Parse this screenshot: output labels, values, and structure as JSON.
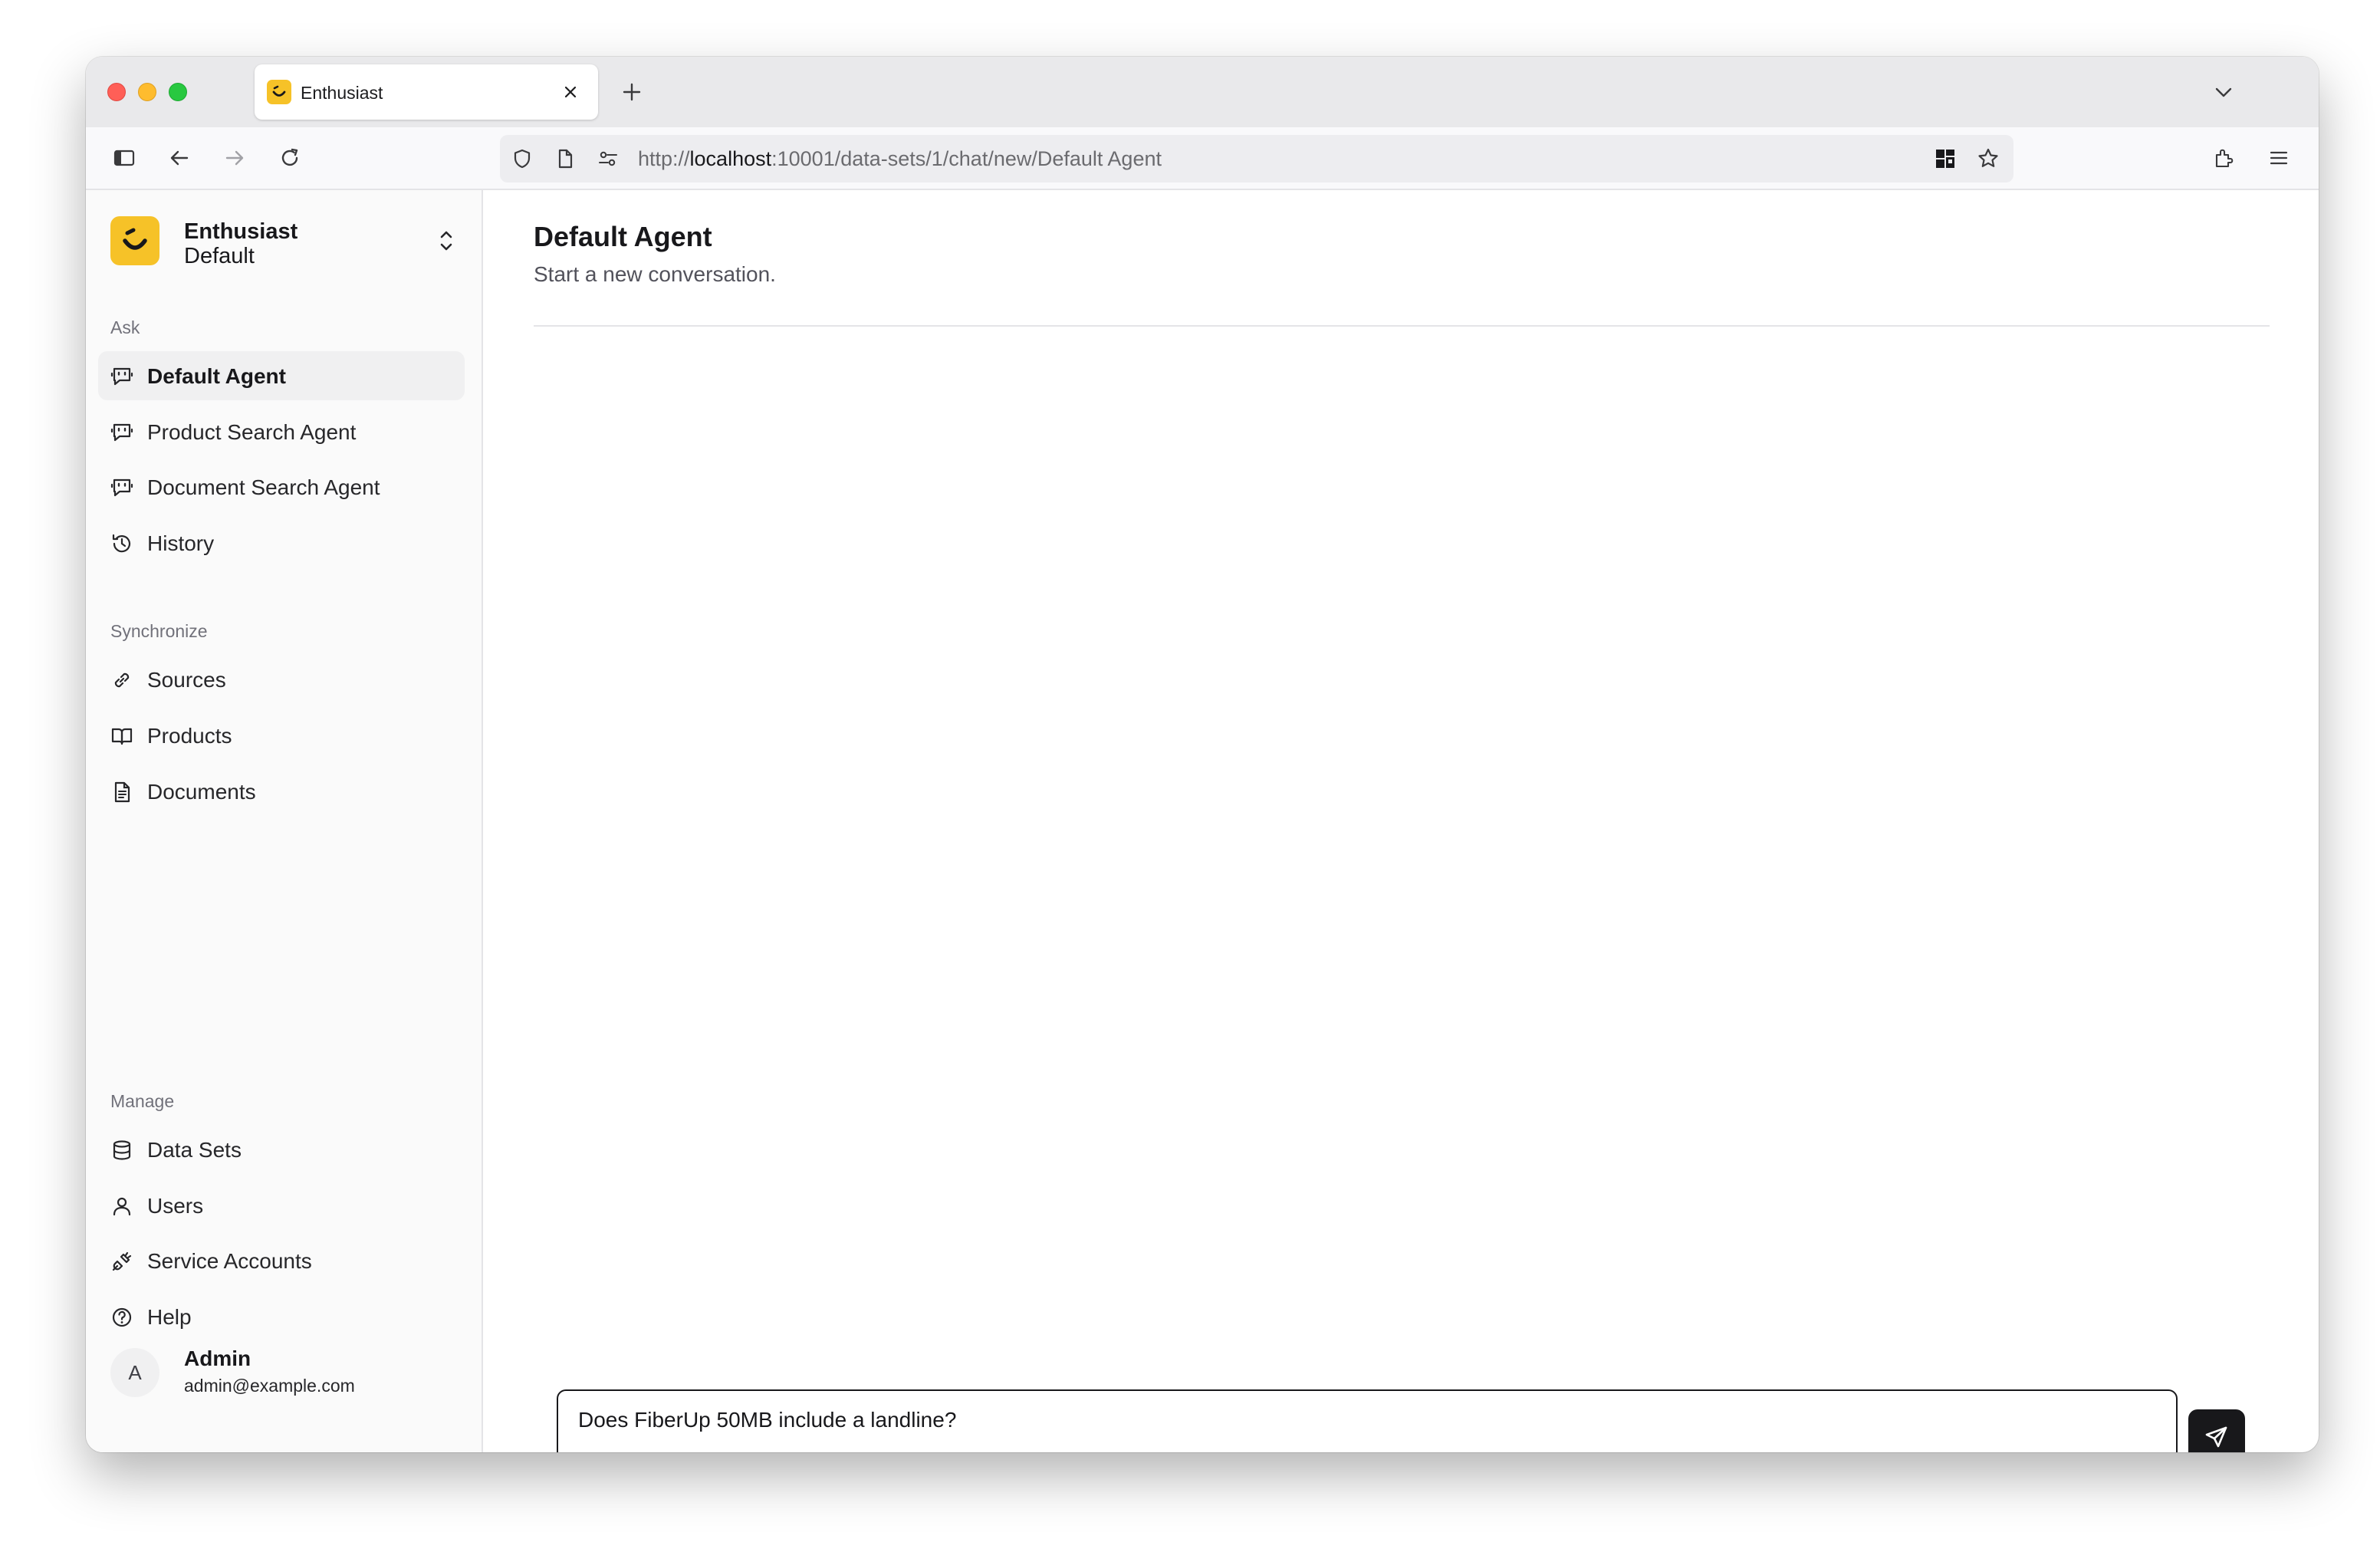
{
  "browser": {
    "tab_title": "Enthusiast",
    "url_scheme": "http://",
    "url_host": "localhost",
    "url_rest": ":10001/data-sets/1/chat/new/Default Agent"
  },
  "org": {
    "name": "Enthusiast",
    "subtitle": "Default"
  },
  "sidebar": {
    "groups": [
      {
        "label": "Ask",
        "items": [
          {
            "label": "Default Agent",
            "icon": "bot-message-icon",
            "active": true
          },
          {
            "label": "Product Search Agent",
            "icon": "bot-message-icon"
          },
          {
            "label": "Document Search Agent",
            "icon": "bot-message-icon"
          },
          {
            "label": "History",
            "icon": "history-icon"
          }
        ]
      },
      {
        "label": "Synchronize",
        "items": [
          {
            "label": "Sources",
            "icon": "link-icon"
          },
          {
            "label": "Products",
            "icon": "book-icon"
          },
          {
            "label": "Documents",
            "icon": "document-icon"
          }
        ]
      },
      {
        "label": "Manage",
        "items": [
          {
            "label": "Data Sets",
            "icon": "database-icon"
          },
          {
            "label": "Users",
            "icon": "user-icon"
          },
          {
            "label": "Service Accounts",
            "icon": "plug-icon"
          },
          {
            "label": "Help",
            "icon": "help-circle-icon"
          }
        ]
      }
    ]
  },
  "user": {
    "initial": "A",
    "name": "Admin",
    "email": "admin@example.com"
  },
  "main": {
    "title": "Default Agent",
    "subtitle": "Start a new conversation."
  },
  "composer": {
    "value": "Does FiberUp 50MB include a landline?"
  },
  "colors": {
    "brand_yellow": "#f6c228",
    "send_button": "#18181b",
    "sidebar_bg": "#fafafa"
  }
}
